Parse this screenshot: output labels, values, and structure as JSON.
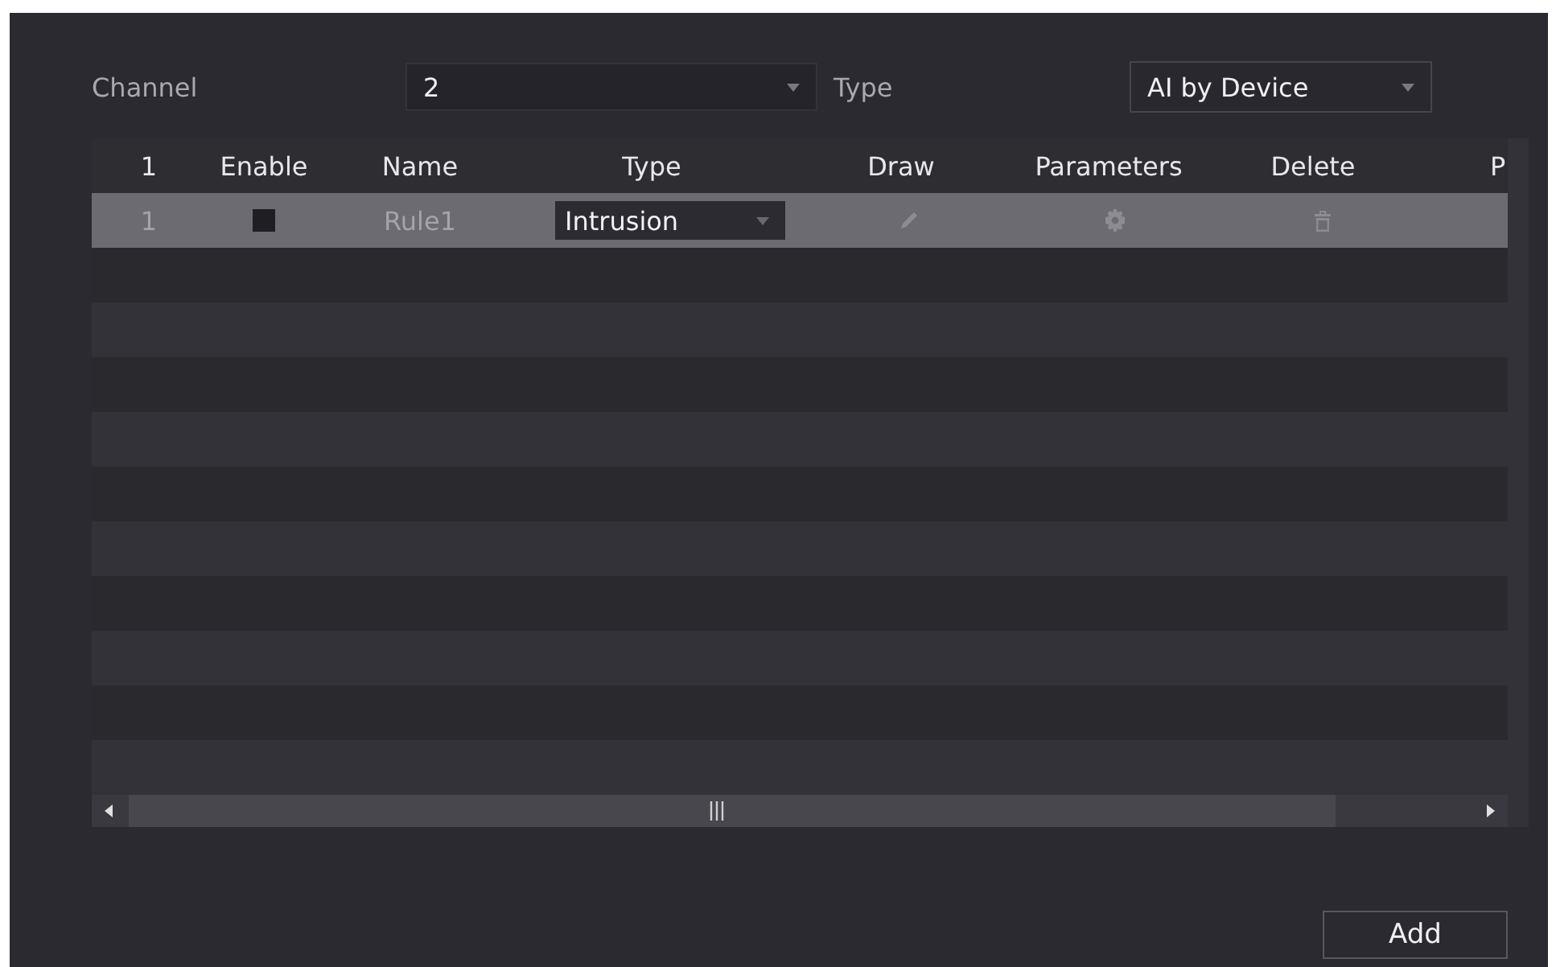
{
  "channel": {
    "label": "Channel",
    "value": "2"
  },
  "type_filter": {
    "label": "Type",
    "value": "AI by Device"
  },
  "table": {
    "columns": [
      "1",
      "Enable",
      "Name",
      "Type",
      "Draw",
      "Parameters",
      "Delete",
      "P"
    ],
    "rows": [
      {
        "index": "1",
        "enabled": false,
        "name": "Rule1",
        "type": "Intrusion",
        "selected": true
      }
    ]
  },
  "buttons": [
    "Add"
  ]
}
